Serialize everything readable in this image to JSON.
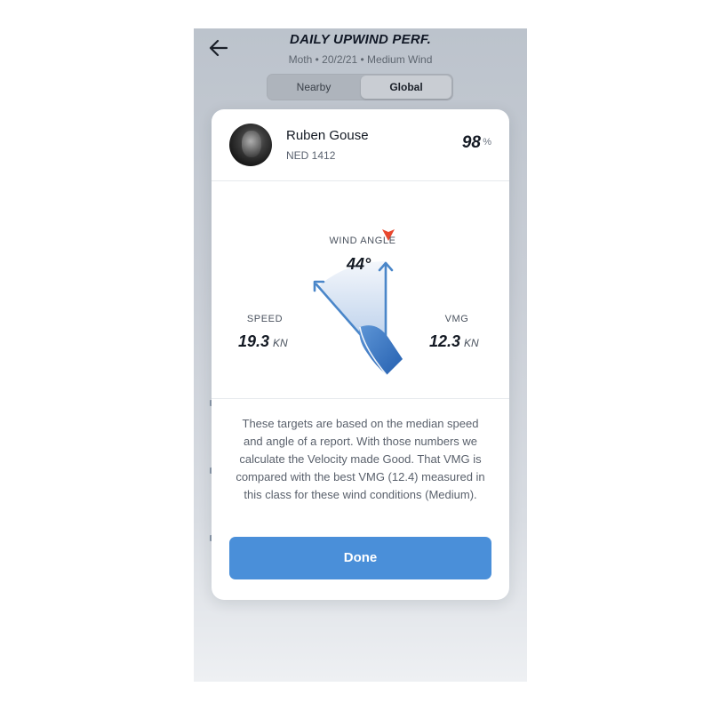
{
  "header": {
    "title": "DAILY UPWIND PERF.",
    "subtitle": "Moth • 20/2/21 • Medium Wind"
  },
  "tabs": [
    {
      "label": "Nearby",
      "selected": false
    },
    {
      "label": "Global",
      "selected": true
    }
  ],
  "card": {
    "user": {
      "name": "Ruben Gouse",
      "sail_number": "NED 1412"
    },
    "score": {
      "value": "98",
      "unit": "%"
    },
    "wind_angle": {
      "label": "WIND ANGLE",
      "value": "44°",
      "indicator_color": "#e8472e"
    },
    "speed": {
      "label": "SPEED",
      "value": "19.3",
      "unit": "KN"
    },
    "vmg": {
      "label": "VMG",
      "value": "12.3",
      "unit": "KN"
    },
    "explanation": "These targets are based on the median speed and angle of a report. With those numbers we calculate the Velocity made Good. That VMG is compared with the best VMG (12.4) measured in this class for these wind conditions (Medium).",
    "done_label": "Done"
  },
  "colors": {
    "accent": "#4a8fd9",
    "arrow": "#4a86c9",
    "boat": "#2f6fbf",
    "wind_marker": "#e8472e"
  }
}
